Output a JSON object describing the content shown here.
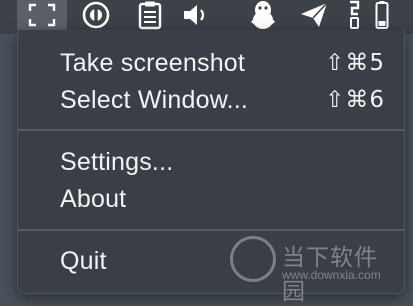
{
  "menubar": {
    "icons": [
      {
        "name": "screenshot-selection-icon"
      },
      {
        "name": "password-manager-icon"
      },
      {
        "name": "clipboard-icon"
      },
      {
        "name": "volume-icon"
      },
      {
        "name": "qq-penguin-icon"
      },
      {
        "name": "send-plane-icon"
      },
      {
        "name": "mobile-device-icon"
      },
      {
        "name": "battery-icon"
      }
    ]
  },
  "menu": {
    "items": [
      {
        "label": "Take screenshot",
        "shortcut": "⇧⌘5"
      },
      {
        "label": "Select Window...",
        "shortcut": "⇧⌘6"
      },
      {
        "label": "Settings..."
      },
      {
        "label": "About"
      },
      {
        "label": "Quit"
      }
    ]
  },
  "watermark": {
    "chinese_text": "当下软件园",
    "url": "www.downxia.com"
  },
  "colors": {
    "menubar_bg": "#3d4148",
    "menu_bg": "#3a3f47",
    "text": "#f2f2f2",
    "active_item_bg": "#5a5f68"
  }
}
